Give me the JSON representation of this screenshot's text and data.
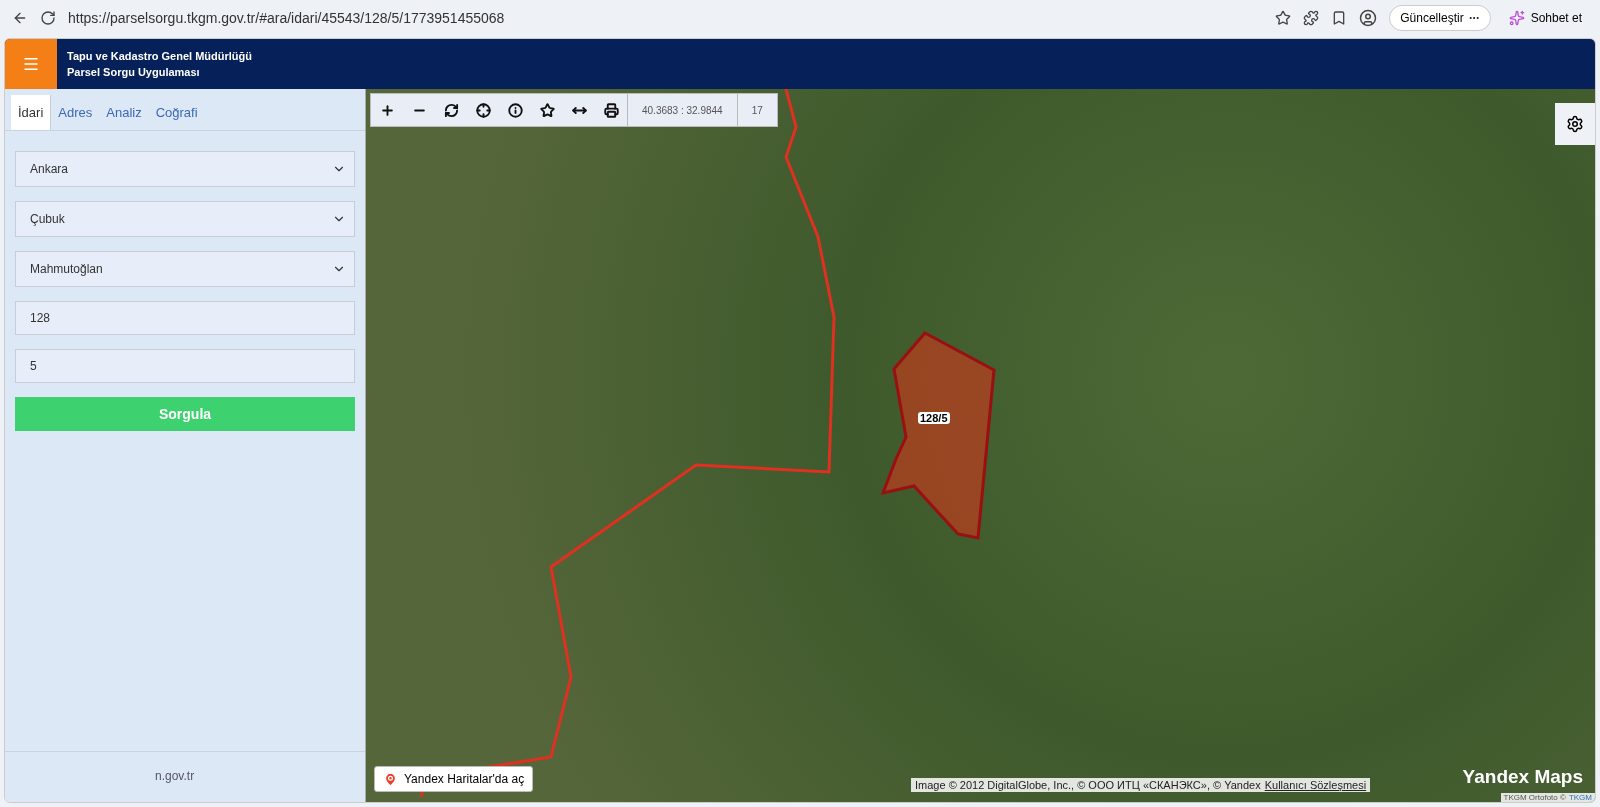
{
  "browser": {
    "url": "https://parselsorgu.tkgm.gov.tr/#ara/idari/45543/128/5/1773951455068",
    "update_button": "Güncelleştir",
    "chat_button": "Sohbet et"
  },
  "header": {
    "title_line_1": "Tapu ve Kadastro Genel Müdürlüğü",
    "title_line_2": "Parsel Sorgu Uygulaması"
  },
  "sidebar": {
    "tabs": [
      {
        "label": "İdari",
        "selected": true
      },
      {
        "label": "Adres",
        "selected": false
      },
      {
        "label": "Analiz",
        "selected": false
      },
      {
        "label": "Coğrafi",
        "selected": false
      }
    ],
    "fields": [
      {
        "kind": "select",
        "value": "Ankara"
      },
      {
        "kind": "select",
        "value": "Çubuk"
      },
      {
        "kind": "select",
        "value": "Mahmutoğlan"
      },
      {
        "kind": "input",
        "value": "128"
      },
      {
        "kind": "input",
        "value": "5"
      }
    ],
    "submit": "Sorgula",
    "footer": "n.gov.tr"
  },
  "map": {
    "toolbar": {
      "coordinates": "40.3683 : 32.9844",
      "zoom": "17"
    },
    "parcel_label": "128/5",
    "open_button": "Yandex Haritalar'da aç",
    "attribution": "Image © 2012 DigitalGlobe, Inc., © ООО ИТЦ «СКАНЭКС», © Yandex",
    "attribution_link": "Kullanıcı Sözleşmesi",
    "logo": "Yandex Maps",
    "ortofoto": "TKGM Ortofoto ©",
    "ortofoto_link": "TKGM"
  }
}
